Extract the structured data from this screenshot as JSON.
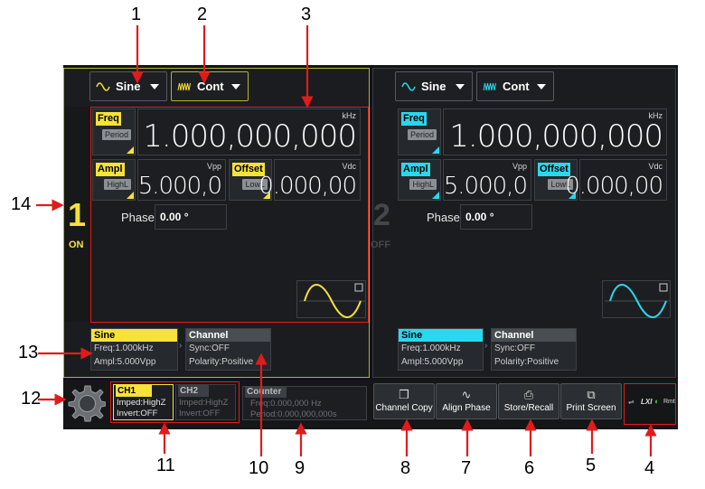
{
  "callouts": [
    "1",
    "2",
    "3",
    "4",
    "5",
    "6",
    "7",
    "8",
    "9",
    "10",
    "11",
    "12",
    "13",
    "14"
  ],
  "ch1": {
    "wave_label": "Sine",
    "mode_label": "Cont",
    "freq_tag": "Freq",
    "period_tag": "Period",
    "freq_unit": "kHz",
    "freq_value": "1.000,000,000",
    "ampl_tag": "Ampl",
    "highl_tag": "HighL",
    "ampl_unit": "Vpp",
    "ampl_value": "5.000,0",
    "offset_tag": "Offset",
    "lowl_tag": "LowL",
    "offset_unit": "Vdc",
    "offset_value": "0.000,00",
    "phase_label": "Phase",
    "phase_value": "0.00 °",
    "channel_number": "1",
    "state": "ON",
    "summary_wave_title": "Sine",
    "summary_freq": "Freq:1.000kHz",
    "summary_ampl": "Ampl:5.000Vpp",
    "summary_channel_title": "Channel",
    "summary_sync": "Sync:OFF",
    "summary_polarity": "Polarity:Positive"
  },
  "ch2": {
    "wave_label": "Sine",
    "mode_label": "Cont",
    "freq_tag": "Freq",
    "period_tag": "Period",
    "freq_unit": "kHz",
    "freq_value": "1.000,000,000",
    "ampl_tag": "Ampl",
    "highl_tag": "HighL",
    "ampl_unit": "Vpp",
    "ampl_value": "5.000,0",
    "offset_tag": "Offset",
    "lowl_tag": "LowL",
    "offset_unit": "Vdc",
    "offset_value": "0.000,00",
    "phase_label": "Phase",
    "phase_value": "0.00 °",
    "channel_number": "2",
    "state": "OFF",
    "summary_wave_title": "Sine",
    "summary_freq": "Freq:1.000kHz",
    "summary_ampl": "Ampl:5.000Vpp",
    "summary_channel_title": "Channel",
    "summary_sync": "Sync:OFF",
    "summary_polarity": "Polarity:Positive"
  },
  "bottom": {
    "ch1_title": "CH1",
    "ch1_imped": "Imped:HighZ",
    "ch1_invert": "Invert:OFF",
    "ch2_title": "CH2",
    "ch2_imped": "Imped:HighZ",
    "ch2_invert": "Invert:OFF",
    "counter_title": "Counter",
    "counter_freq": "Freq:0.000,000 Hz",
    "counter_period": "Period:0.000,000,000s",
    "channel_copy": "Channel Copy",
    "align_phase": "Align Phase",
    "store_recall": "Store/Recall",
    "print_screen": "Print Screen",
    "status_lxi": "LXI",
    "status_rmt": "Rmt"
  },
  "colors": {
    "ch1_accent": "#f6e23a",
    "ch2_accent": "#2ad8ee",
    "annotation_red": "#e11b1b",
    "background": "#111315"
  }
}
